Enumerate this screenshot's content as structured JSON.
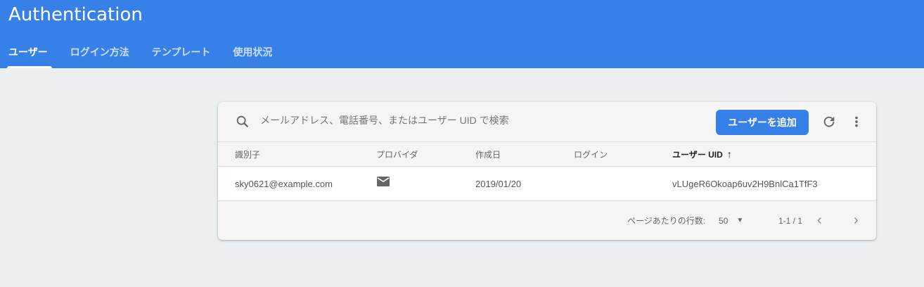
{
  "header": {
    "title": "Authentication",
    "tabs": [
      {
        "label": "ユーザー",
        "active": true
      },
      {
        "label": "ログイン方法"
      },
      {
        "label": "テンプレート"
      },
      {
        "label": "使用状況"
      }
    ]
  },
  "toolbar": {
    "search_placeholder": "メールアドレス、電話番号、またはユーザー UID で検索",
    "add_user_label": "ユーザーを追加"
  },
  "table": {
    "columns": [
      "識別子",
      "プロバイダ",
      "作成日",
      "ログイン",
      "ユーザー UID"
    ],
    "rows": [
      {
        "identifier": "sky0621@example.com",
        "provider": "mail-icon",
        "created": "2019/01/20",
        "login": "",
        "uid": "vLUgeR6Okoap6uv2H9BnlCa1TfF3"
      }
    ]
  },
  "pagination": {
    "rows_per_page_label": "ページあたりの行数:",
    "rows_per_page": "50",
    "range": "1-1 / 1"
  },
  "colors": {
    "accent": "#3780e8"
  }
}
